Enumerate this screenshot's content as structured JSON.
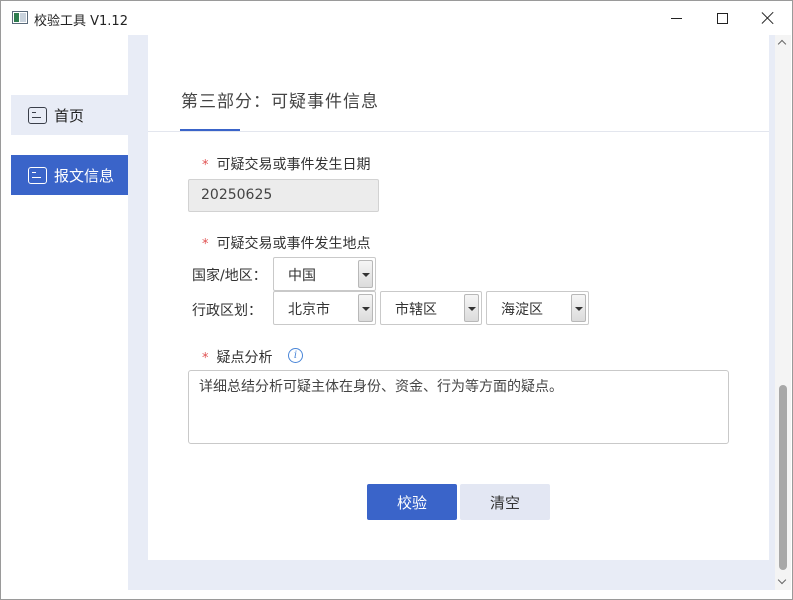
{
  "window": {
    "title": "校验工具 V1.12",
    "controls": {
      "minimize": "minimize",
      "maximize": "maximize",
      "close": "close"
    }
  },
  "sidebar": {
    "items": [
      {
        "label": "首页",
        "icon": "document-icon",
        "active": false
      },
      {
        "label": "报文信息",
        "icon": "document-icon",
        "active": true
      }
    ]
  },
  "section": {
    "title": "第三部分：可疑事件信息"
  },
  "fields": {
    "date": {
      "required_mark": "*",
      "label": "可疑交易或事件发生日期",
      "value": "20250625"
    },
    "location": {
      "required_mark": "*",
      "label": "可疑交易或事件发生地点",
      "country_label": "国家/地区：",
      "country_value": "中国",
      "region_label": "行政区划：",
      "province_value": "北京市",
      "city_value": "市辖区",
      "district_value": "海淀区"
    },
    "analysis": {
      "required_mark": "*",
      "label": "疑点分析",
      "info_glyph": "i",
      "value": "详细总结分析可疑主体在身份、资金、行为等方面的疑点。"
    }
  },
  "actions": {
    "validate_label": "校验",
    "clear_label": "清空"
  },
  "colors": {
    "accent": "#3a64c9",
    "required": "#e05050",
    "content_bg": "#e8ecf6"
  }
}
